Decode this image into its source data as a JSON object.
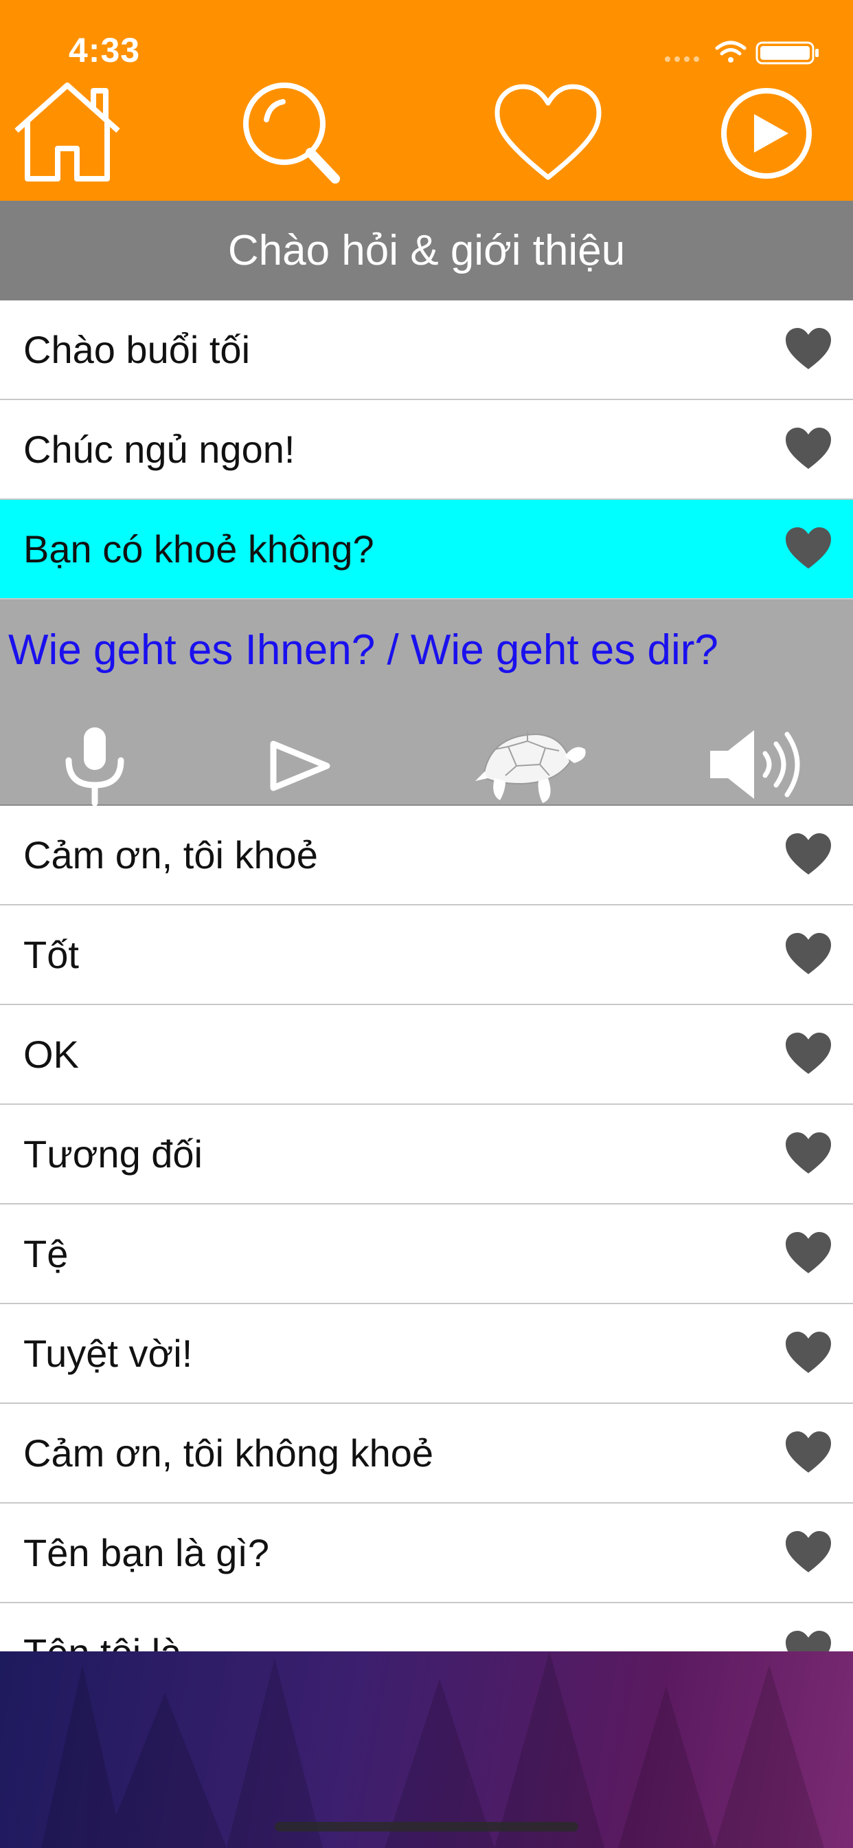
{
  "status_bar": {
    "time": "4:33"
  },
  "nav": {
    "icons": [
      "home-icon",
      "search-icon",
      "heart-icon",
      "play-circle-icon"
    ]
  },
  "section": {
    "title": "Chào hỏi & giới thiệu"
  },
  "phrases_top": [
    {
      "label": "Chào buổi tối"
    },
    {
      "label": "Chúc ngủ ngon!"
    },
    {
      "label": "Bạn có khoẻ không?",
      "selected": true
    }
  ],
  "detail": {
    "translation": "Wie geht es Ihnen? / Wie geht es dir?",
    "controls": [
      "microphone-icon",
      "play-icon",
      "turtle-slow-icon",
      "speaker-icon"
    ]
  },
  "phrases_bottom": [
    {
      "label": "Cảm ơn, tôi khoẻ"
    },
    {
      "label": "Tốt"
    },
    {
      "label": "OK"
    },
    {
      "label": "Tương đối"
    },
    {
      "label": "Tệ"
    },
    {
      "label": "Tuyệt vời!"
    },
    {
      "label": "Cảm ơn, tôi không khoẻ"
    },
    {
      "label": "Tên bạn là gì?"
    },
    {
      "label": "Tên tôi là..."
    }
  ],
  "colors": {
    "header": "#ff9100",
    "section_bg": "#808080",
    "selected_row": "#00ffff",
    "translation_text": "#1a10ee",
    "heart": "#555555"
  }
}
